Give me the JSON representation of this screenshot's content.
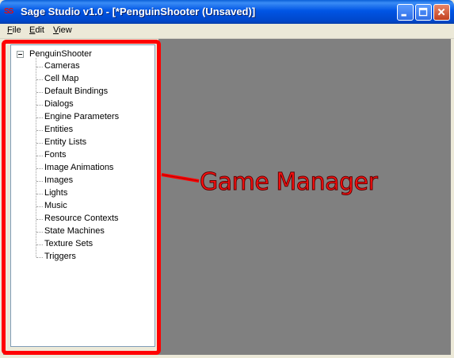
{
  "window": {
    "title": "Sage Studio v1.0 - [*PenguinShooter (Unsaved)]",
    "app_icon_text": "SS"
  },
  "menu": [
    "File",
    "Edit",
    "View"
  ],
  "tree": {
    "root": "PenguinShooter",
    "expanded": true,
    "children": [
      "Cameras",
      "Cell Map",
      "Default Bindings",
      "Dialogs",
      "Engine Parameters",
      "Entities",
      "Entity Lists",
      "Fonts",
      "Image Animations",
      "Images",
      "Lights",
      "Music",
      "Resource Contexts",
      "State Machines",
      "Texture Sets",
      "Triggers"
    ]
  },
  "annotation": {
    "label": "Game Manager",
    "color": "#ff0000"
  },
  "colors": {
    "titlebar": "#0055e5",
    "client_background": "#808080",
    "highlight": "#ff0000"
  }
}
